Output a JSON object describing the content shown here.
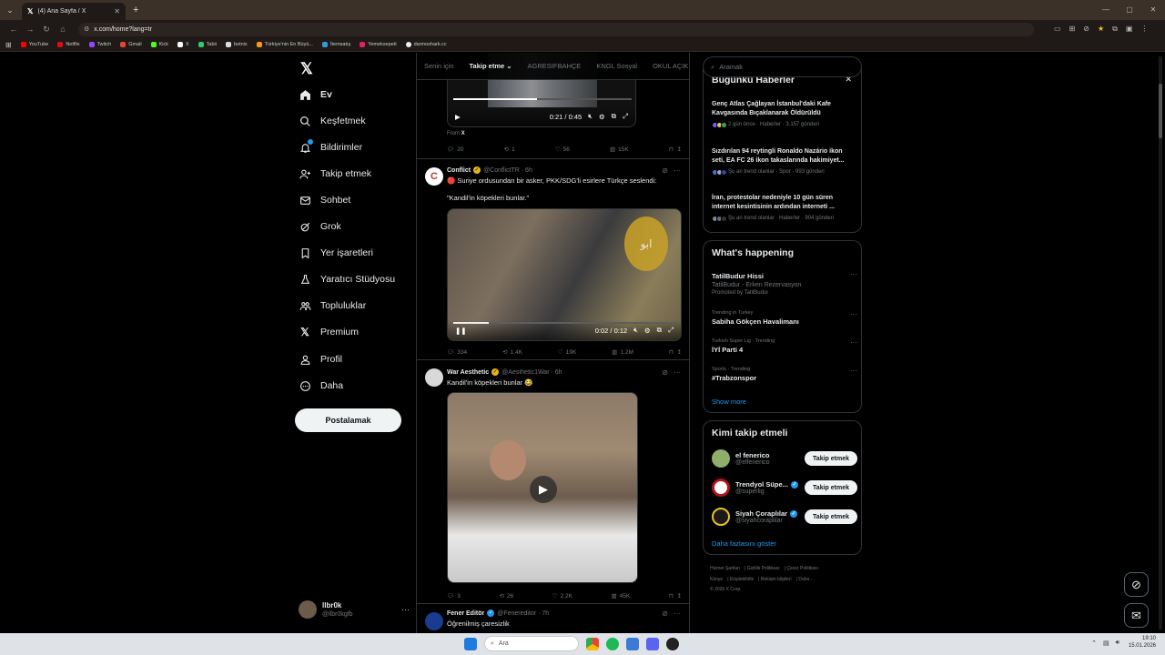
{
  "browser": {
    "tab_title": "(4) Ana Sayfa / X",
    "url": "x.com/home?lang=tr",
    "bookmarks": [
      "YouTube",
      "Netflix",
      "Twitch",
      "Gmail",
      "Kick",
      "X",
      "Tabii",
      "botnix",
      "Türkiye'nin En Büyü...",
      "İtemsatış",
      "Yemeksepeti",
      "darmoshark.cc"
    ]
  },
  "nav": {
    "items": [
      "Ev",
      "Keşfetmek",
      "Bildirimler",
      "Takip etmek",
      "Sohbet",
      "Grok",
      "Yer işaretleri",
      "Yaratıcı Stüdyosu",
      "Topluluklar",
      "Premium",
      "Profil",
      "Daha"
    ],
    "post_label": "Postalamak",
    "account_name": "llbr0k",
    "account_handle": "@llbr0kgfb"
  },
  "timeline": {
    "tabs": [
      "Senin için",
      "Takip etme",
      "AGRESIFBAHÇE",
      "KNGL Sosyal",
      "OKUL AÇIK"
    ],
    "top_tweet": {
      "video_time": "0:21 / 0:45",
      "from_label": "From",
      "from_source": "X",
      "stats": {
        "replies": "20",
        "reposts": "1",
        "likes": "56",
        "views": "15K"
      }
    },
    "tweets": [
      {
        "name": "Conflict",
        "handle": "@ConflictTR · 6h",
        "line1": "🔴 Suriye ordusundan bir asker, PKK/SDG'li esirlere Türkçe seslendi:",
        "line2": "\"Kandil'in köpekleri bunlar.\"",
        "video_time": "0:02 / 0:12",
        "stats": {
          "replies": "334",
          "reposts": "1.4K",
          "likes": "19K",
          "views": "1.2M"
        }
      },
      {
        "name": "War Aesthetic",
        "handle": "@Aesthetic1War · 6h",
        "line1": "Kandil'in köpekleri bunlar 😂",
        "stats": {
          "replies": "3",
          "reposts": "26",
          "likes": "2.2K",
          "views": "45K"
        }
      },
      {
        "name": "Fener Editör",
        "handle": "@Fenereditor · 7h",
        "line1": "Öğrenilmiş çaresizlik"
      }
    ]
  },
  "right": {
    "search_placeholder": "Aramak",
    "news_title": "Bugünkü Haberler",
    "news": [
      {
        "title": "Genç Atlas Çağlayan İstanbul'daki Kafe Kavgasında Bıçaklanarak Öldürüldü",
        "meta": "2 gün önce · Haberler · 3.157 gönderi"
      },
      {
        "title": "Sızdırılan 94 reytingli Ronaldo Nazário ikon seti, EA FC 26 ikon takaslarında hakimiyet...",
        "meta": "Şu an trend olanlar · Spor · 993 gönderi"
      },
      {
        "title": "İran, protestolar nedeniyle 10 gün süren internet kesintisinin ardından interneti ...",
        "meta": "Şu an trend olanlar · Haberler · 904 gönderi"
      }
    ],
    "happening_title": "What's happening",
    "trends": [
      {
        "context": "",
        "title": "TatilBudur Hissi",
        "sub": "TatilBudur - Erken Rezervasyon",
        "promo": "Promoted by TatilBudur"
      },
      {
        "context": "Trending in Turkey",
        "title": "Sabiha Gökçen Havalimanı",
        "sub": "",
        "promo": ""
      },
      {
        "context": "Turkish Super Lig · Trending",
        "title": "İYİ Parti 4",
        "sub": "",
        "promo": ""
      },
      {
        "context": "Sports · Trending",
        "title": "#Trabzonspor",
        "sub": "",
        "promo": ""
      }
    ],
    "show_more": "Show more",
    "who_title": "Kimi takip etmeli",
    "who": [
      {
        "name": "el fenerico",
        "handle": "@elfenerico",
        "verified": false
      },
      {
        "name": "Trendyol Süpe...",
        "handle": "@superlig",
        "verified": true
      },
      {
        "name": "Siyah Çoraplılar",
        "handle": "@siyahcoraplilar",
        "verified": true
      }
    ],
    "follow_label": "Takip etmek",
    "more_label": "Daha fazlasını göster",
    "footer": [
      "Hizmet Şartları",
      "Gizlilik Politikası",
      "Çerez Politikası",
      "Künye",
      "Erişilebilirlik",
      "Reklam bilgileri",
      "Daha ...",
      "© 2026 X Corp."
    ]
  },
  "taskbar": {
    "search_placeholder": "Ara",
    "time": "19:10",
    "date": "15.01.2026"
  }
}
